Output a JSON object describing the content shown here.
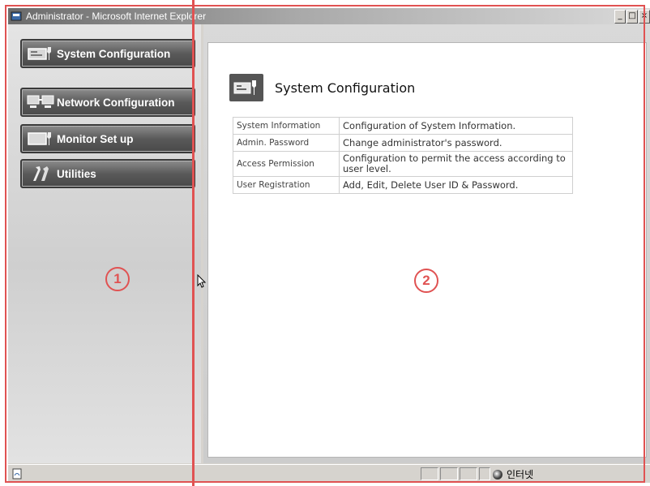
{
  "window": {
    "title": "Administrator - Microsoft Internet Explorer",
    "controls": [
      "_",
      "□",
      "×"
    ]
  },
  "sidebar": {
    "items": [
      {
        "label": "System Configuration",
        "icon": "system-config-icon"
      },
      {
        "label": "Network Configuration",
        "icon": "network-config-icon"
      },
      {
        "label": "Monitor Set up",
        "icon": "monitor-setup-icon"
      },
      {
        "label": "Utilities",
        "icon": "utilities-icon"
      }
    ]
  },
  "markers": {
    "left": "1",
    "right": "2"
  },
  "content": {
    "title": "System Configuration",
    "rows": [
      {
        "name": "System Information",
        "desc": "Configuration of System Information."
      },
      {
        "name": "Admin. Password",
        "desc": "Change administrator's password."
      },
      {
        "name": "Access Permission",
        "desc": "Configuration to permit the access according to user level."
      },
      {
        "name": "User Registration",
        "desc": "Add, Edit, Delete User ID & Password."
      }
    ]
  },
  "statusbar": {
    "zone": "인터넷"
  },
  "colors": {
    "annotation": "#e05252",
    "button": "#5a5a5a",
    "content_bg": "#ffffff"
  }
}
